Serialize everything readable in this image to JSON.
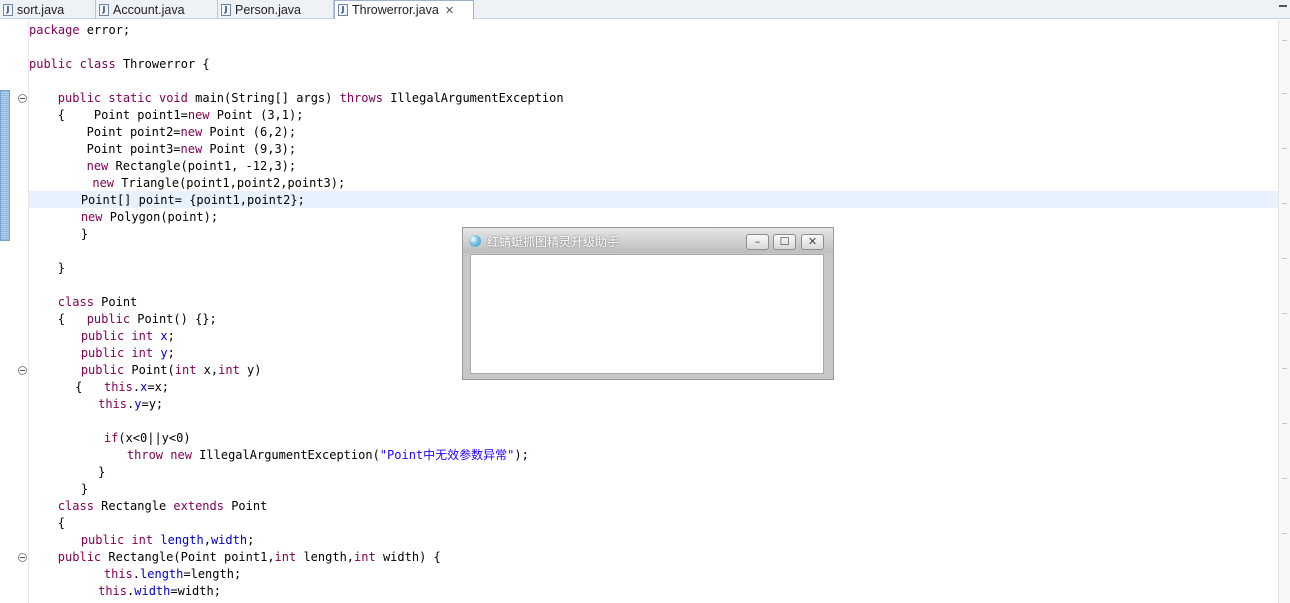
{
  "tabs": [
    {
      "label": "sort.java",
      "close": ""
    },
    {
      "label": "Account.java",
      "close": ""
    },
    {
      "label": "Person.java",
      "close": ""
    },
    {
      "label": "Throwerror.java",
      "close": "✕"
    }
  ],
  "file_icon_glyph": "J",
  "icons": {
    "file": "java-file-icon",
    "close": "close-icon",
    "fold": "fold-toggle-icon",
    "window_minimize": "minimize-icon",
    "window_maximize": "maximize-icon",
    "window_close": "close-icon"
  },
  "colors": {
    "keyword": "#7f0055",
    "field": "#0000c0",
    "string": "#2a00ff",
    "current_line": "#e8f2fe"
  },
  "code_lines": [
    {
      "indent": 0,
      "text": "package error;"
    },
    {
      "indent": 0,
      "text": ""
    },
    {
      "indent": 0,
      "text": "public class Throwerror {"
    },
    {
      "indent": 0,
      "text": ""
    },
    {
      "indent": 5,
      "text": "public static void main(String[] args) throws IllegalArgumentException"
    },
    {
      "indent": 5,
      "text": "{    Point point1=new Point (3,1);"
    },
    {
      "indent": 10,
      "text": "Point point2=new Point (6,2);"
    },
    {
      "indent": 10,
      "text": "Point point3=new Point (9,3);"
    },
    {
      "indent": 10,
      "text": "new Rectangle(point1, -12,3);"
    },
    {
      "indent": 11,
      "text": "new Triangle(point1,point2,point3);"
    },
    {
      "indent": 9,
      "text": "Point[] point= {point1,point2};"
    },
    {
      "indent": 9,
      "text": "new Polygon(point);"
    },
    {
      "indent": 9,
      "text": "}"
    },
    {
      "indent": 0,
      "text": ""
    },
    {
      "indent": 5,
      "text": "}"
    },
    {
      "indent": 0,
      "text": ""
    },
    {
      "indent": 5,
      "text": "class Point"
    },
    {
      "indent": 5,
      "text": "{   public Point() {};"
    },
    {
      "indent": 9,
      "text": "public int x;"
    },
    {
      "indent": 9,
      "text": "public int y;"
    },
    {
      "indent": 9,
      "text": "public Point(int x,int y)"
    },
    {
      "indent": 8,
      "text": "{   this.x=x;"
    },
    {
      "indent": 12,
      "text": "this.y=y;"
    },
    {
      "indent": 0,
      "text": ""
    },
    {
      "indent": 13,
      "text": "if(x<0||y<0)"
    },
    {
      "indent": 17,
      "text": "throw new IllegalArgumentException(\"Point中无效参数异常\");"
    },
    {
      "indent": 12,
      "text": "}"
    },
    {
      "indent": 9,
      "text": "}"
    },
    {
      "indent": 5,
      "text": "class Rectangle extends Point"
    },
    {
      "indent": 5,
      "text": "{"
    },
    {
      "indent": 9,
      "text": "public int length,width;"
    },
    {
      "indent": 5,
      "text": "public Rectangle(Point point1,int length,int width) {"
    },
    {
      "indent": 13,
      "text": "this.length=length;"
    },
    {
      "indent": 12,
      "text": "this.width=width;"
    }
  ],
  "floating_window": {
    "title": "红蜻蜓抓图精灵升级助手",
    "minimize_label": "–",
    "maximize_label": "☐",
    "close_label": "✕"
  }
}
